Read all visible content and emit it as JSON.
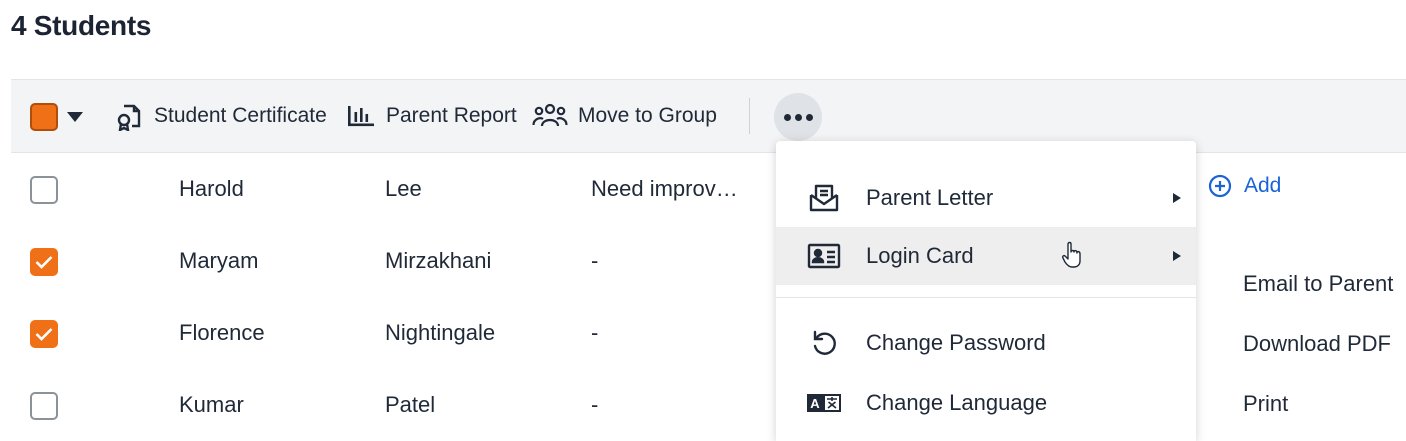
{
  "page": {
    "title": "4 Students"
  },
  "toolbar": {
    "actions": [
      {
        "label": "Student Certificate",
        "icon": "certificate-icon"
      },
      {
        "label": "Parent Report",
        "icon": "bar-chart-icon"
      },
      {
        "label": "Move to Group",
        "icon": "group-icon"
      }
    ],
    "more_icon": "more-horizontal-icon",
    "select_all_state": "partial"
  },
  "students": [
    {
      "first": "Harold",
      "last": "Lee",
      "note": "Need improv…",
      "checked": false
    },
    {
      "first": "Maryam",
      "last": "Mirzakhani",
      "note": "-",
      "checked": true
    },
    {
      "first": "Florence",
      "last": "Nightingale",
      "note": "-",
      "checked": true
    },
    {
      "first": "Kumar",
      "last": "Patel",
      "note": "-",
      "checked": false
    }
  ],
  "add_link": {
    "label": "Add",
    "icon": "plus-circle-icon"
  },
  "more_menu": {
    "items": [
      {
        "label": "Parent Letter",
        "icon": "envelope-open-icon",
        "has_submenu": true
      },
      {
        "label": "Login Card",
        "icon": "id-card-icon",
        "has_submenu": true,
        "hovered": true
      },
      {
        "label": "Change Password",
        "icon": "undo-icon",
        "has_submenu": false
      },
      {
        "label": "Change Language",
        "icon": "translate-icon",
        "has_submenu": false
      }
    ]
  },
  "login_card_submenu": {
    "items": [
      {
        "label": "Email to Parent"
      },
      {
        "label": "Download PDF"
      },
      {
        "label": "Print"
      }
    ]
  },
  "colors": {
    "accent": "#f07018",
    "link": "#1a63d6",
    "toolbar_bg": "#f3f4f6"
  }
}
